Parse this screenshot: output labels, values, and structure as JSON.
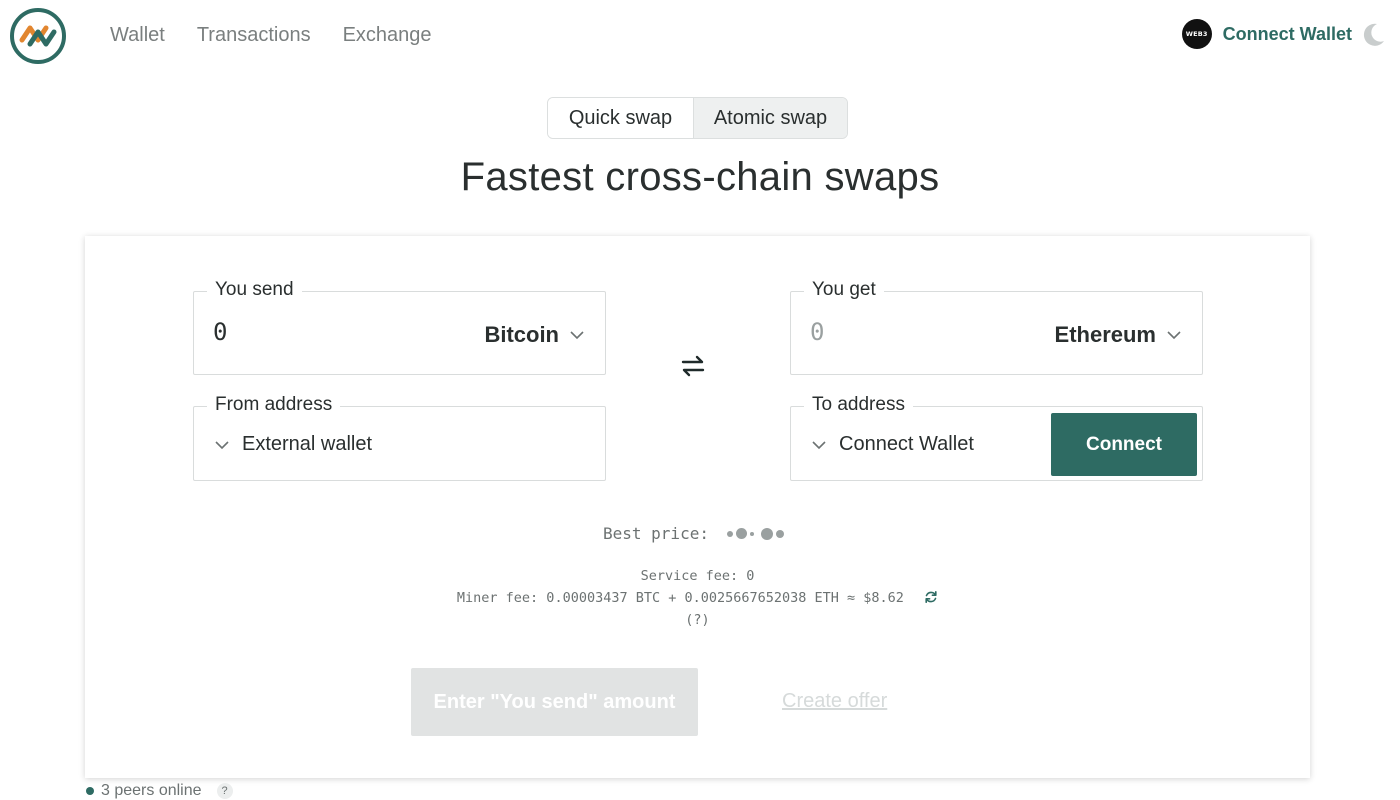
{
  "header": {
    "logo_icon": "swap-logo-icon",
    "nav": [
      "Wallet",
      "Transactions",
      "Exchange"
    ],
    "web3_badge": "WEB3",
    "connect_wallet_label": "Connect Wallet",
    "theme_icon": "moon-icon"
  },
  "mode_toggle": {
    "quick": "Quick swap",
    "atomic": "Atomic swap",
    "selected": "Atomic swap"
  },
  "headline": "Fastest cross-chain swaps",
  "send": {
    "legend": "You send",
    "amount": "0",
    "coin": "Bitcoin"
  },
  "get": {
    "legend": "You get",
    "amount": "0",
    "coin": "Ethereum"
  },
  "from_address": {
    "legend": "From address",
    "value": "External wallet"
  },
  "to_address": {
    "legend": "To address",
    "value": "Connect Wallet",
    "button": "Connect"
  },
  "pricing": {
    "best_price_label": "Best price:",
    "service_fee": "Service fee: 0",
    "miner_fee": "Miner fee: 0.00003437 BTC + 0.0025667652038 ETH ≈ $8.62",
    "help": "(?)"
  },
  "actions": {
    "enter_amount": "Enter \"You send\" amount",
    "create_offer": "Create offer"
  },
  "footer": {
    "peers": "3 peers online",
    "help": "?"
  },
  "colors": {
    "accent": "#2e6b63",
    "logo_orange": "#e2862f",
    "disabled_button": "#e1e3e3"
  }
}
